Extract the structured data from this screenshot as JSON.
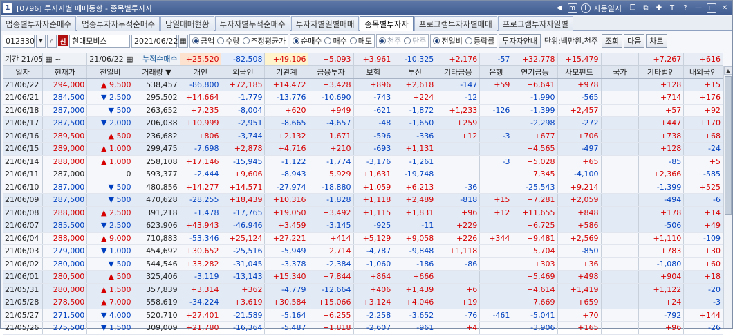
{
  "titlebar": {
    "number": "1",
    "title": "[0796] 투자자별 매매동향 - 종목별투자자",
    "autosave_label": "자동일지",
    "menu_icon": "menu-box-icon",
    "info_icon": "info-icon"
  },
  "tabs": [
    {
      "label": "업종별투자자순매수",
      "active": false
    },
    {
      "label": "업종투자자누적순매수",
      "active": false
    },
    {
      "label": "당일매매현황",
      "active": false
    },
    {
      "label": "투자자별누적순매수",
      "active": false
    },
    {
      "label": "투자자별일별매매",
      "active": false
    },
    {
      "label": "종목별투자자",
      "active": true
    },
    {
      "label": "프로그램투자자별매매",
      "active": false
    },
    {
      "label": "프로그램투자자일별",
      "active": false
    }
  ],
  "toolbar": {
    "code": "012330",
    "shin": "신",
    "stock_name": "현대모비스",
    "date": "2021/06/22",
    "group1": [
      {
        "label": "금액",
        "on": true
      },
      {
        "label": "수량",
        "on": false
      },
      {
        "label": "추정평균가",
        "on": false
      }
    ],
    "group2": [
      {
        "label": "순매수",
        "on": true
      },
      {
        "label": "매수",
        "on": false
      },
      {
        "label": "매도",
        "on": false
      }
    ],
    "group3": [
      {
        "label": "천주",
        "on": true,
        "disabled": true
      },
      {
        "label": "단주",
        "on": false,
        "disabled": true
      }
    ],
    "group4": [
      {
        "label": "전일비",
        "on": true
      },
      {
        "label": "등락률",
        "on": false
      }
    ],
    "guide_button": "투자자안내",
    "unit_text": "단위:백만원,천주",
    "query_button": "조회",
    "next_button": "다음",
    "chart_button": "차트"
  },
  "period": {
    "label": "기간",
    "from": "21/05/22",
    "to": "21/06/22",
    "cum_label": "누적순매수"
  },
  "totals": [
    "+25,520",
    "-82,508",
    "+49,106",
    "+5,093",
    "+3,961",
    "-10,325",
    "+2,176",
    "-57",
    "+32,778",
    "+15,479",
    "",
    "+7,267",
    "+616"
  ],
  "columns": [
    "일자",
    "현재가",
    "전일비",
    "거래량",
    "개인",
    "외국인",
    "기관계",
    "금융투자",
    "보험",
    "투신",
    "기타금융",
    "은행",
    "연기금등",
    "사모펀드",
    "국가",
    "기타법인",
    "내외국인"
  ],
  "rows": [
    {
      "date": "21/06/22",
      "price": "294,000",
      "dir": "up",
      "change": "9,500",
      "volume": "538,457",
      "v": [
        "-86,800",
        "+72,185",
        "+14,472",
        "+3,428",
        "+896",
        "+2,618",
        "-147",
        "+59",
        "+6,641",
        "+978",
        "",
        "+128",
        "+15"
      ],
      "hl": true
    },
    {
      "date": "21/06/21",
      "price": "284,500",
      "dir": "down",
      "change": "2,500",
      "volume": "295,502",
      "v": [
        "+14,664",
        "-1,779",
        "-13,776",
        "-10,690",
        "-743",
        "+224",
        "-12",
        "",
        "-1,990",
        "-565",
        "",
        "+714",
        "+176"
      ],
      "hl": false
    },
    {
      "date": "21/06/18",
      "price": "287,000",
      "dir": "down",
      "change": "500",
      "volume": "263,652",
      "v": [
        "+7,235",
        "-8,004",
        "+620",
        "+949",
        "-621",
        "-1,872",
        "+1,233",
        "-126",
        "-1,399",
        "+2,457",
        "",
        "+57",
        "+92"
      ],
      "hl": false
    },
    {
      "date": "21/06/17",
      "price": "287,500",
      "dir": "down",
      "change": "2,000",
      "volume": "206,038",
      "v": [
        "+10,999",
        "-2,951",
        "-8,665",
        "-4,657",
        "-48",
        "-1,650",
        "+259",
        "",
        "-2,298",
        "-272",
        "",
        "+447",
        "+170"
      ],
      "hl": true
    },
    {
      "date": "21/06/16",
      "price": "289,500",
      "dir": "up",
      "change": "500",
      "volume": "236,682",
      "v": [
        "+806",
        "-3,744",
        "+2,132",
        "+1,671",
        "-596",
        "-336",
        "+12",
        "-3",
        "+677",
        "+706",
        "",
        "+738",
        "+68"
      ],
      "hl": true
    },
    {
      "date": "21/06/15",
      "price": "289,000",
      "dir": "up",
      "change": "1,000",
      "volume": "299,475",
      "v": [
        "-7,698",
        "+2,878",
        "+4,716",
        "+210",
        "-693",
        "+1,131",
        "",
        "",
        "+4,565",
        "-497",
        "",
        "+128",
        "-24"
      ],
      "hl": true
    },
    {
      "date": "21/06/14",
      "price": "288,000",
      "dir": "up",
      "change": "1,000",
      "volume": "258,108",
      "v": [
        "+17,146",
        "-15,945",
        "-1,122",
        "-1,774",
        "-3,176",
        "-1,261",
        "",
        "-3",
        "+5,028",
        "+65",
        "",
        "-85",
        "+5"
      ],
      "hl": false
    },
    {
      "date": "21/06/11",
      "price": "287,000",
      "dir": "none",
      "change": "0",
      "volume": "593,377",
      "v": [
        "-2,444",
        "+9,606",
        "-8,943",
        "+5,929",
        "+1,631",
        "-19,748",
        "",
        "",
        "+7,345",
        "-4,100",
        "",
        "+2,366",
        "-585"
      ],
      "hl": false
    },
    {
      "date": "21/06/10",
      "price": "287,000",
      "dir": "down",
      "change": "500",
      "volume": "480,856",
      "v": [
        "+14,277",
        "+14,571",
        "-27,974",
        "-18,880",
        "+1,059",
        "+6,213",
        "-36",
        "",
        "-25,543",
        "+9,214",
        "",
        "-1,399",
        "+525"
      ],
      "hl": false
    },
    {
      "date": "21/06/09",
      "price": "287,500",
      "dir": "down",
      "change": "500",
      "volume": "470,628",
      "v": [
        "-28,255",
        "+18,439",
        "+10,316",
        "-1,828",
        "+1,118",
        "+2,489",
        "-818",
        "+15",
        "+7,281",
        "+2,059",
        "",
        "-494",
        "-6"
      ],
      "hl": true
    },
    {
      "date": "21/06/08",
      "price": "288,000",
      "dir": "up",
      "change": "2,500",
      "volume": "391,218",
      "v": [
        "-1,478",
        "-17,765",
        "+19,050",
        "+3,492",
        "+1,115",
        "+1,831",
        "+96",
        "+12",
        "+11,655",
        "+848",
        "",
        "+178",
        "+14"
      ],
      "hl": true
    },
    {
      "date": "21/06/07",
      "price": "285,500",
      "dir": "down",
      "change": "2,500",
      "volume": "623,906",
      "v": [
        "+43,943",
        "-46,946",
        "+3,459",
        "-3,145",
        "-925",
        "-11",
        "+229",
        "",
        "+6,725",
        "+586",
        "",
        "-506",
        "+49"
      ],
      "hl": true
    },
    {
      "date": "21/06/04",
      "price": "288,000",
      "dir": "up",
      "change": "9,000",
      "volume": "710,883",
      "v": [
        "-53,346",
        "+25,124",
        "+27,221",
        "+414",
        "+5,129",
        "+9,058",
        "+226",
        "+344",
        "+9,481",
        "+2,569",
        "",
        "+1,110",
        "-109"
      ],
      "hl": false
    },
    {
      "date": "21/06/03",
      "price": "279,000",
      "dir": "down",
      "change": "1,000",
      "volume": "454,692",
      "v": [
        "+30,652",
        "-25,516",
        "-5,949",
        "+2,714",
        "-4,787",
        "-9,848",
        "+1,118",
        "",
        "+5,704",
        "-850",
        "",
        "+783",
        "+30"
      ],
      "hl": false
    },
    {
      "date": "21/06/02",
      "price": "280,000",
      "dir": "down",
      "change": "500",
      "volume": "544,546",
      "v": [
        "+33,282",
        "-31,045",
        "-3,378",
        "-2,384",
        "-1,060",
        "-186",
        "-86",
        "",
        "+303",
        "+36",
        "",
        "-1,080",
        "+60"
      ],
      "hl": false
    },
    {
      "date": "21/06/01",
      "price": "280,500",
      "dir": "up",
      "change": "500",
      "volume": "325,406",
      "v": [
        "-3,119",
        "-13,143",
        "+15,340",
        "+7,844",
        "+864",
        "+666",
        "",
        "",
        "+5,469",
        "+498",
        "",
        "+904",
        "+18"
      ],
      "hl": true
    },
    {
      "date": "21/05/31",
      "price": "280,000",
      "dir": "up",
      "change": "1,500",
      "volume": "357,839",
      "v": [
        "+3,314",
        "+362",
        "-4,779",
        "-12,664",
        "+406",
        "+1,439",
        "+6",
        "",
        "+4,614",
        "+1,419",
        "",
        "+1,122",
        "-20"
      ],
      "hl": true
    },
    {
      "date": "21/05/28",
      "price": "278,500",
      "dir": "up",
      "change": "7,000",
      "volume": "558,619",
      "v": [
        "-34,224",
        "+3,619",
        "+30,584",
        "+15,066",
        "+3,124",
        "+4,046",
        "+19",
        "",
        "+7,669",
        "+659",
        "",
        "+24",
        "-3"
      ],
      "hl": true
    },
    {
      "date": "21/05/27",
      "price": "271,500",
      "dir": "down",
      "change": "4,000",
      "volume": "520,710",
      "v": [
        "+27,401",
        "-21,589",
        "-5,164",
        "+6,255",
        "-2,258",
        "-3,652",
        "-76",
        "-461",
        "-5,041",
        "+70",
        "",
        "-792",
        "+144"
      ],
      "hl": false
    },
    {
      "date": "21/05/26",
      "price": "275,500",
      "dir": "down",
      "change": "1,500",
      "volume": "309,009",
      "v": [
        "+21,780",
        "-16,364",
        "-5,487",
        "+1,818",
        "-2,607",
        "-961",
        "+4",
        "",
        "-3,906",
        "+165",
        "",
        "+96",
        "-26"
      ],
      "hl": false
    }
  ]
}
